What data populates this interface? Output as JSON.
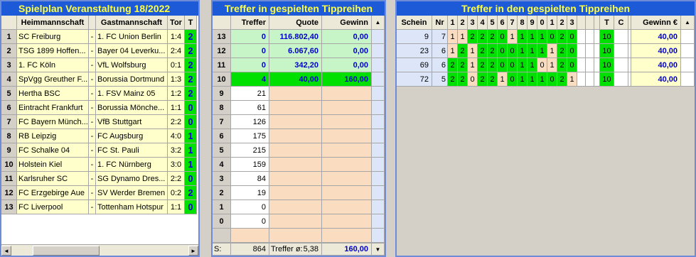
{
  "spielplan": {
    "title": "Spielplan Veranstaltung 18/2022",
    "headers": {
      "home": "Heimmannschaft",
      "away": "Gastmannschaft",
      "tor": "Tor",
      "t": "T"
    },
    "rows": [
      {
        "nr": "1",
        "home": "SC Freiburg",
        "sep": "-",
        "away": "1. FC Union Berlin",
        "tor": "1:4",
        "t": "2"
      },
      {
        "nr": "2",
        "home": "TSG 1899 Hoffen...",
        "sep": "-",
        "away": "Bayer 04 Leverku...",
        "tor": "2:4",
        "t": "2"
      },
      {
        "nr": "3",
        "home": "1. FC Köln",
        "sep": "-",
        "away": "VfL Wolfsburg",
        "tor": "0:1",
        "t": "2"
      },
      {
        "nr": "4",
        "home": "SpVgg Greuther F...",
        "sep": "-",
        "away": "Borussia Dortmund",
        "tor": "1:3",
        "t": "2"
      },
      {
        "nr": "5",
        "home": "Hertha BSC",
        "sep": "-",
        "away": "1. FSV Mainz 05",
        "tor": "1:2",
        "t": "2"
      },
      {
        "nr": "6",
        "home": "Eintracht Frankfurt",
        "sep": "-",
        "away": "Borussia Mönche...",
        "tor": "1:1",
        "t": "0"
      },
      {
        "nr": "7",
        "home": "FC Bayern Münch...",
        "sep": "-",
        "away": "VfB Stuttgart",
        "tor": "2:2",
        "t": "0"
      },
      {
        "nr": "8",
        "home": "RB Leipzig",
        "sep": "-",
        "away": "FC Augsburg",
        "tor": "4:0",
        "t": "1"
      },
      {
        "nr": "9",
        "home": "FC Schalke 04",
        "sep": "-",
        "away": "FC St. Pauli",
        "tor": "3:2",
        "t": "1"
      },
      {
        "nr": "10",
        "home": "Holstein Kiel",
        "sep": "-",
        "away": "1. FC Nürnberg",
        "tor": "3:0",
        "t": "1"
      },
      {
        "nr": "11",
        "home": "Karlsruher SC",
        "sep": "-",
        "away": "SG Dynamo Dres...",
        "tor": "2:2",
        "t": "0"
      },
      {
        "nr": "12",
        "home": "FC Erzgebirge Aue",
        "sep": "-",
        "away": "SV Werder Bremen",
        "tor": "0:2",
        "t": "2"
      },
      {
        "nr": "13",
        "home": "FC Liverpool",
        "sep": "-",
        "away": "Tottenham Hotspur",
        "tor": "1:1",
        "t": "0"
      }
    ],
    "scroll_left_glyph": "◄",
    "scroll_right_glyph": "►"
  },
  "treffer": {
    "title": "Treffer in gespielten Tippreihen",
    "headers": {
      "treffer": "Treffer",
      "quote": "Quote",
      "gewinn": "Gewinn",
      "sort": "▲"
    },
    "rows": [
      {
        "n": "13",
        "treffer": "0",
        "quote": "116.802,40",
        "gewinn": "0,00",
        "style": "win"
      },
      {
        "n": "12",
        "treffer": "0",
        "quote": "6.067,60",
        "gewinn": "0,00",
        "style": "win"
      },
      {
        "n": "11",
        "treffer": "0",
        "quote": "342,20",
        "gewinn": "0,00",
        "style": "win"
      },
      {
        "n": "10",
        "treffer": "4",
        "quote": "40,00",
        "gewinn": "160,00",
        "style": "hit"
      },
      {
        "n": "9",
        "treffer": "21",
        "quote": "",
        "gewinn": "",
        "style": "none"
      },
      {
        "n": "8",
        "treffer": "61",
        "quote": "",
        "gewinn": "",
        "style": "none"
      },
      {
        "n": "7",
        "treffer": "126",
        "quote": "",
        "gewinn": "",
        "style": "none"
      },
      {
        "n": "6",
        "treffer": "175",
        "quote": "",
        "gewinn": "",
        "style": "none"
      },
      {
        "n": "5",
        "treffer": "215",
        "quote": "",
        "gewinn": "",
        "style": "none"
      },
      {
        "n": "4",
        "treffer": "159",
        "quote": "",
        "gewinn": "",
        "style": "none"
      },
      {
        "n": "3",
        "treffer": "84",
        "quote": "",
        "gewinn": "",
        "style": "none"
      },
      {
        "n": "2",
        "treffer": "19",
        "quote": "",
        "gewinn": "",
        "style": "none"
      },
      {
        "n": "1",
        "treffer": "0",
        "quote": "",
        "gewinn": "",
        "style": "none"
      },
      {
        "n": "0",
        "treffer": "0",
        "quote": "",
        "gewinn": "",
        "style": "none"
      }
    ],
    "footer": {
      "s_label": "S:",
      "sum": "864",
      "avg_label": "Treffer ø:",
      "avg": "5,38",
      "gewinn": "160,00",
      "dropdown": "▼"
    }
  },
  "scheine": {
    "title": "Treffer in den gespielten Tippreihen",
    "headers": {
      "schein": "Schein",
      "nr": "Nr",
      "cols": [
        "1",
        "2",
        "3",
        "4",
        "5",
        "6",
        "7",
        "8",
        "9",
        "0",
        "1",
        "2",
        "3"
      ],
      "t": "T",
      "c": "C",
      "gewinn": "Gewinn €",
      "sort": "▲"
    },
    "rows": [
      {
        "schein": "9",
        "nr": "7",
        "tips": [
          "1",
          "1",
          "2",
          "2",
          "2",
          "0",
          "1",
          "1",
          "1",
          "1",
          "0",
          "2",
          "0"
        ],
        "t": "10",
        "c": "",
        "gewinn": "40,00"
      },
      {
        "schein": "23",
        "nr": "6",
        "tips": [
          "1",
          "2",
          "1",
          "2",
          "2",
          "0",
          "0",
          "1",
          "1",
          "1",
          "1",
          "2",
          "0"
        ],
        "t": "10",
        "c": "",
        "gewinn": "40,00"
      },
      {
        "schein": "69",
        "nr": "6",
        "tips": [
          "2",
          "2",
          "1",
          "2",
          "2",
          "0",
          "0",
          "1",
          "1",
          "0",
          "1",
          "2",
          "0"
        ],
        "t": "10",
        "c": "",
        "gewinn": "40,00"
      },
      {
        "schein": "72",
        "nr": "5",
        "tips": [
          "2",
          "2",
          "0",
          "2",
          "2",
          "1",
          "0",
          "1",
          "1",
          "1",
          "0",
          "2",
          "1"
        ],
        "t": "10",
        "c": "",
        "gewinn": "40,00"
      }
    ]
  },
  "colors": {
    "panel_frame": "#6e8bd8",
    "title_bg": "#1c5ad8",
    "title_fg": "#ffff40",
    "hit_green": "#00e000",
    "win_green": "#c8f5c8",
    "peach": "#fadcc0",
    "cream": "#ffffcc",
    "value_blue": "#0000cc"
  }
}
